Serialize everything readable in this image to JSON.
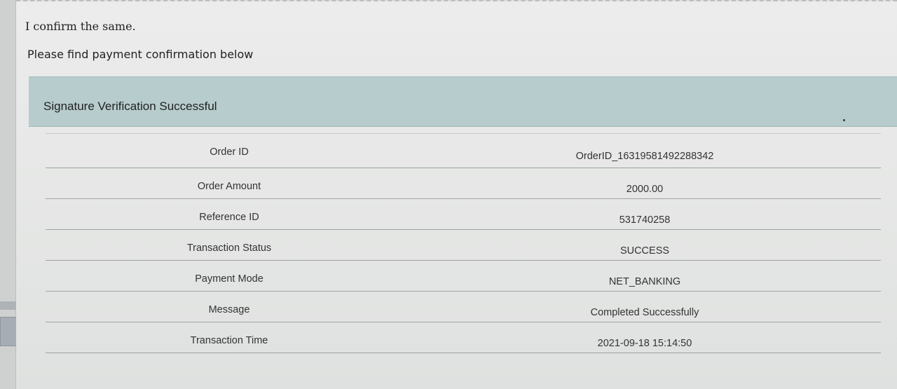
{
  "email": {
    "confirm_text": "I confirm the same.",
    "intro_text": "Please find payment confirmation below"
  },
  "banner": {
    "title": "Signature Verification Successful"
  },
  "details": [
    {
      "label": "Order ID",
      "value": "OrderID_16319581492288342"
    },
    {
      "label": "Order Amount",
      "value": "2000.00"
    },
    {
      "label": "Reference ID",
      "value": "531740258"
    },
    {
      "label": "Transaction Status",
      "value": "SUCCESS"
    },
    {
      "label": "Payment Mode",
      "value": "NET_BANKING"
    },
    {
      "label": "Message",
      "value": "Completed Successfully"
    },
    {
      "label": "Transaction Time",
      "value": "2021-09-18 15:14:50"
    }
  ]
}
